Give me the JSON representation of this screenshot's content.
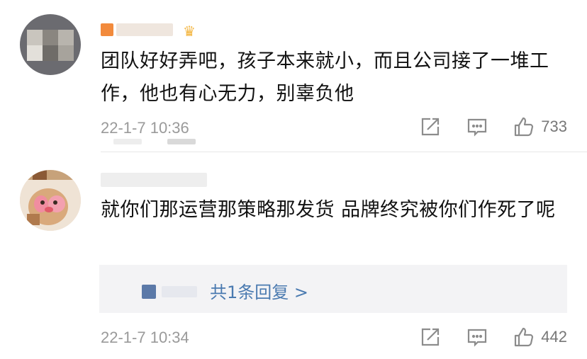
{
  "comments": [
    {
      "username": "",
      "text": "团队好好弄吧，孩子本来就小，而且公司接了一堆工作，他也有心无力，别辜负他",
      "time": "22-1-7 10:36",
      "likes": "733"
    },
    {
      "username": "",
      "text": "就你们那运营那策略那发货  品牌终究被你们作死了呢",
      "time": "22-1-7 10:34",
      "likes": "442",
      "replies_label": "共1条回复 >"
    }
  ],
  "colors": {
    "link": "#4a7ab0",
    "meta": "#9a9a9a",
    "reply_bg": "#f3f3f5"
  },
  "icons": [
    "share-icon",
    "comment-icon",
    "like-icon"
  ]
}
